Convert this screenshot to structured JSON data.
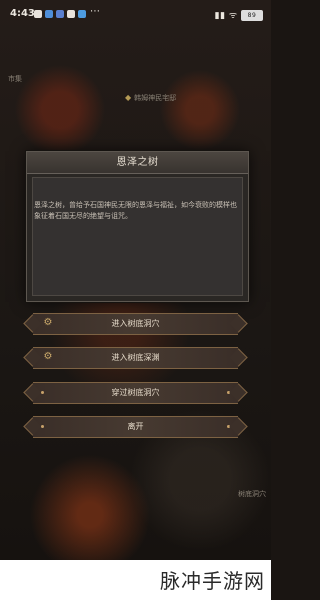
{
  "status": {
    "time": "4:43",
    "signal": "⁝ᯤ 𝄞𝄢",
    "battery": "89"
  },
  "map": {
    "left_label": "市集",
    "pin_label": "韩姆神民宅邸",
    "right_bottom_label": "树底洞穴"
  },
  "dialog": {
    "title": "恩泽之树",
    "text": "恩泽之树，曾给予石国神民无限的恩泽与福祉，如今衰败的模样也象征着石国无尽的绝望与诅咒。"
  },
  "options": [
    {
      "label": "进入树底洞穴",
      "icon": "gear-icon"
    },
    {
      "label": "进入树底深渊",
      "icon": "gear-icon"
    },
    {
      "label": "穿过树底洞穴",
      "icon": ""
    },
    {
      "label": "离开",
      "icon": ""
    }
  ],
  "watermark": {
    "text": "脉冲手游网"
  }
}
